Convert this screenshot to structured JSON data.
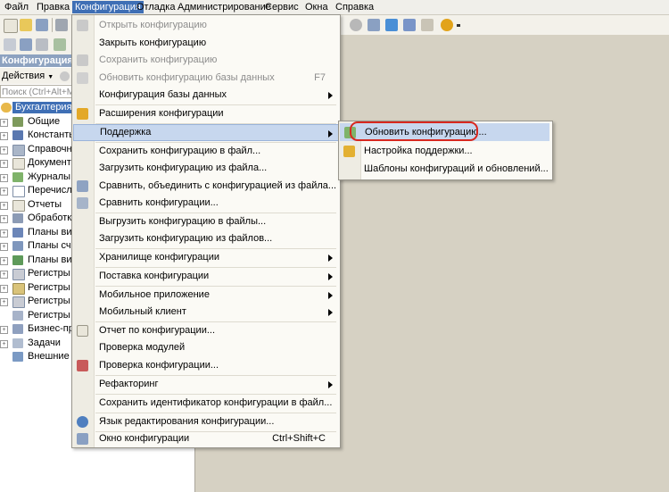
{
  "menubar": {
    "items": [
      "Файл",
      "Правка",
      "Конфигурация",
      "Отладка",
      "Администрирование",
      "Сервис",
      "Окна",
      "Справка"
    ]
  },
  "left_panel": {
    "title": "Конфигурация",
    "actions_label": "Действия",
    "search_placeholder": "Поиск (Ctrl+Alt+M)",
    "root": "БухгалтерияПр",
    "tree": [
      "Общие",
      "Константы",
      "Справочни",
      "Документы",
      "Журналы д",
      "Перечисле",
      "Отчеты",
      "Обработки",
      "Планы видо",
      "Планы счет",
      "Планы видо",
      "Регистры св",
      "Регистры на",
      "Регистры бу",
      "Регистры ра",
      "Бизнес-проц",
      "Задачи",
      "Внешние ис"
    ]
  },
  "config_menu": {
    "items": [
      {
        "label": "Открыть конфигурацию",
        "disabled": true
      },
      {
        "label": "Закрыть конфигурацию"
      },
      {
        "label": "Сохранить конфигурацию",
        "disabled": true
      },
      {
        "label": "Обновить конфигурацию базы данных",
        "shortcut": "F7",
        "disabled": true
      },
      {
        "label": "Конфигурация базы данных",
        "submenu": true
      },
      {
        "label": "Расширения конфигурации"
      },
      {
        "label": "Поддержка",
        "submenu": true,
        "highlighted": true
      },
      {
        "label": "Сохранить конфигурацию в файл..."
      },
      {
        "label": "Загрузить конфигурацию из файла..."
      },
      {
        "label": "Сравнить, объединить с конфигурацией из файла..."
      },
      {
        "label": "Сравнить конфигурации..."
      },
      {
        "label": "Выгрузить конфигурацию в файлы..."
      },
      {
        "label": "Загрузить конфигурацию из файлов..."
      },
      {
        "label": "Хранилище конфигурации",
        "submenu": true
      },
      {
        "label": "Поставка конфигурации",
        "submenu": true
      },
      {
        "label": "Мобильное приложение",
        "submenu": true
      },
      {
        "label": "Мобильный клиент",
        "submenu": true
      },
      {
        "label": "Отчет по конфигурации..."
      },
      {
        "label": "Проверка модулей"
      },
      {
        "label": "Проверка конфигурации..."
      },
      {
        "label": "Рефакторинг",
        "submenu": true
      },
      {
        "label": "Сохранить идентификатор конфигурации в файл..."
      },
      {
        "label": "Язык редактирования конфигурации..."
      },
      {
        "label": "Окно конфигурации",
        "shortcut": "Ctrl+Shift+C"
      }
    ]
  },
  "support_submenu": {
    "items": [
      {
        "label": "Обновить конфигурацию...",
        "highlighted": true
      },
      {
        "label": "Настройка поддержки..."
      },
      {
        "label": "Шаблоны конфигураций и обновлений..."
      }
    ]
  },
  "colors": {
    "menu_highlight": "#c7d7ee",
    "active_menubar": "#3f6fb5",
    "annotation_ring": "#d8281f"
  }
}
